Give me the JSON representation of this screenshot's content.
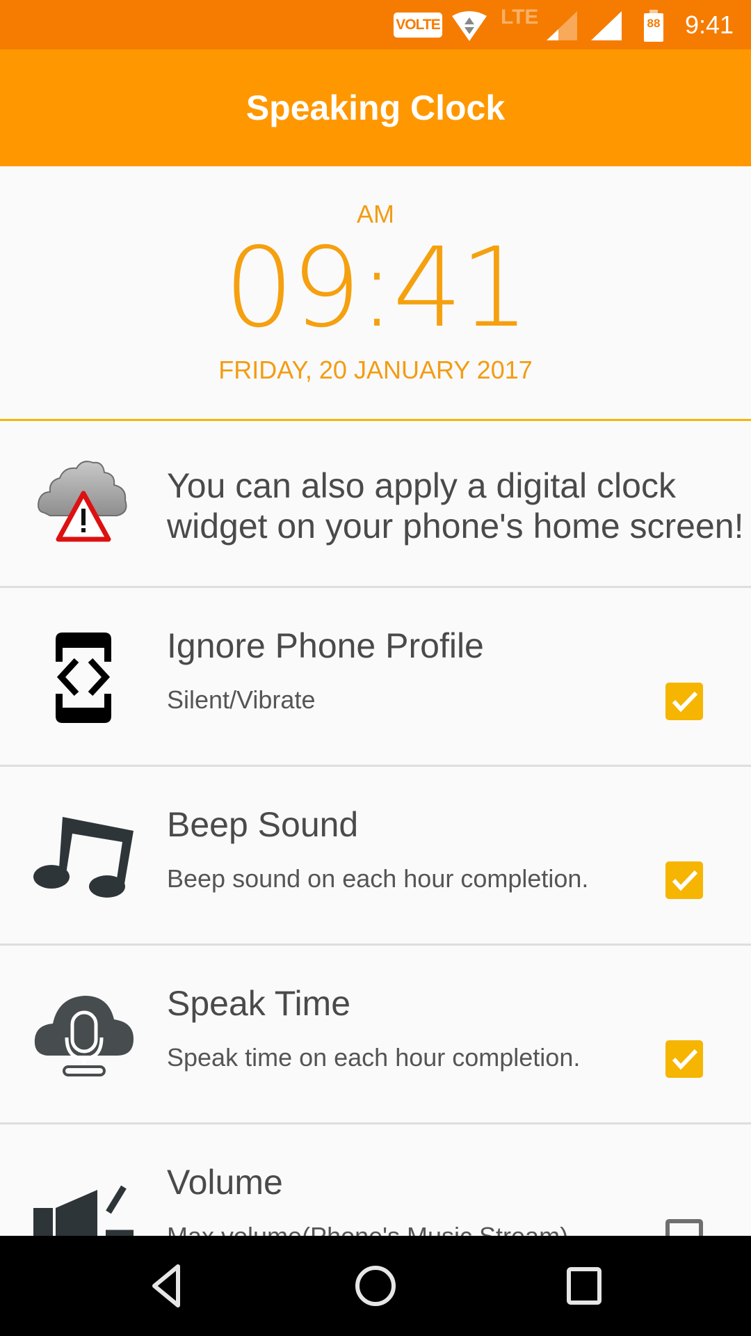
{
  "status_bar": {
    "volte_label": "VOLTE",
    "network_label": "LTE",
    "battery_level": "88",
    "time": "9:41",
    "icons": [
      "volte-icon",
      "wifi-icon",
      "lte-icon",
      "signal-icon",
      "signal-icon",
      "battery-icon"
    ]
  },
  "app_bar": {
    "title": "Speaking Clock"
  },
  "clock": {
    "ampm": "AM",
    "hours": "09",
    "separator": ":",
    "minutes": "41",
    "date": "FRIDAY, 20 JANUARY 2017"
  },
  "tip": {
    "icon": "cloud-warning-icon",
    "line1": "You can also apply a digital clock",
    "line2": "widget on your phone's home screen!"
  },
  "settings": [
    {
      "icon": "phone-profile-icon",
      "title": "Ignore Phone Profile",
      "subtitle": "Silent/Vibrate",
      "checked": true
    },
    {
      "icon": "music-note-icon",
      "title": "Beep Sound",
      "subtitle": "Beep sound on each hour completion.",
      "checked": true
    },
    {
      "icon": "cloud-mic-icon",
      "title": "Speak Time",
      "subtitle": "Speak time on each hour completion.",
      "checked": true
    },
    {
      "icon": "speaker-icon",
      "title": "Volume",
      "subtitle": "Max volume(Phone's Music Stream)",
      "checked": false
    }
  ],
  "nav_bar": {
    "buttons": [
      "back",
      "home",
      "recents"
    ]
  },
  "colors": {
    "status_bar": "#F57C00",
    "app_bar": "#FF9800",
    "accent": "#F5A00F",
    "checkbox": "#F5B500",
    "divider": "#F2B705"
  }
}
